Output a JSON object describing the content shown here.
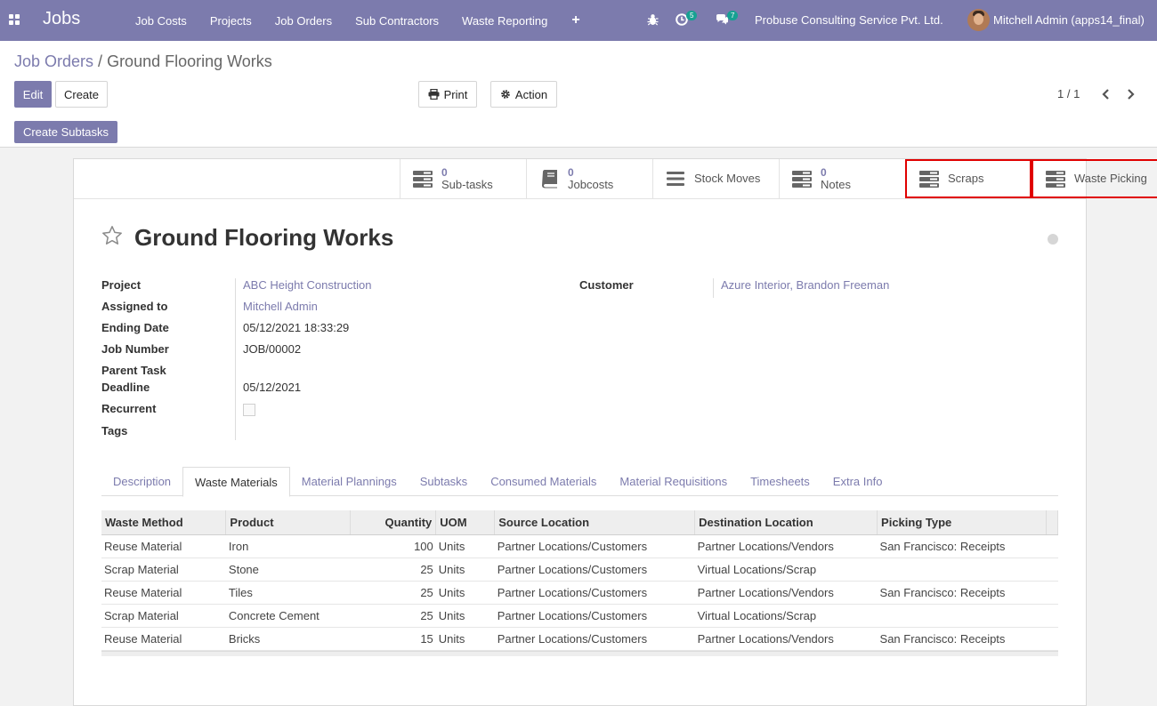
{
  "navbar": {
    "brand": "Jobs",
    "menu": [
      "Job Costs",
      "Projects",
      "Job Orders",
      "Sub Contractors",
      "Waste Reporting"
    ],
    "plus": "+",
    "activity_badge": "5",
    "messages_badge": "7",
    "company": "Probuse Consulting Service Pvt. Ltd.",
    "user": "Mitchell Admin (apps14_final)"
  },
  "breadcrumb": {
    "parent": "Job Orders",
    "separator": "/",
    "current": "Ground Flooring Works"
  },
  "buttons": {
    "edit": "Edit",
    "create": "Create",
    "print": "Print",
    "action": "Action",
    "create_subtasks": "Create Subtasks"
  },
  "pager": "1 / 1",
  "smart_buttons": [
    {
      "value": "0",
      "label": "Sub-tasks",
      "icon": "tasks-icon"
    },
    {
      "value": "0",
      "label": "Jobcosts",
      "icon": "book-icon"
    },
    {
      "value": "",
      "label": "Stock Moves",
      "icon": "list-icon"
    },
    {
      "value": "0",
      "label": "Notes",
      "icon": "tasks-icon"
    },
    {
      "value": "",
      "label": "Scraps",
      "icon": "tasks-icon",
      "highlighted": true
    },
    {
      "value": "",
      "label": "Waste Picking",
      "icon": "tasks-icon",
      "highlighted": true
    }
  ],
  "record": {
    "title": "Ground Flooring Works",
    "fields": {
      "project_label": "Project",
      "project": "ABC Height Construction",
      "assigned_label": "Assigned to",
      "assigned": "Mitchell Admin",
      "ending_label": "Ending Date",
      "ending": "05/12/2021 18:33:29",
      "jobnum_label": "Job Number",
      "jobnum": "JOB/00002",
      "parent_label": "Parent Task",
      "deadline_label": "Deadline",
      "deadline": "05/12/2021",
      "recurrent_label": "Recurrent",
      "tags_label": "Tags",
      "customer_label": "Customer",
      "customer": "Azure Interior, Brandon Freeman"
    }
  },
  "tabs": [
    "Description",
    "Waste Materials",
    "Material Plannings",
    "Subtasks",
    "Consumed Materials",
    "Material Requisitions",
    "Timesheets",
    "Extra Info"
  ],
  "active_tab": "Waste Materials",
  "table": {
    "columns": [
      "Waste Method",
      "Product",
      "Quantity",
      "UOM",
      "Source Location",
      "Destination Location",
      "Picking Type"
    ],
    "rows": [
      [
        "Reuse Material",
        "Iron",
        "100",
        "Units",
        "Partner Locations/Customers",
        "Partner Locations/Vendors",
        "San Francisco: Receipts"
      ],
      [
        "Scrap Material",
        "Stone",
        "25",
        "Units",
        "Partner Locations/Customers",
        "Virtual Locations/Scrap",
        ""
      ],
      [
        "Reuse Material",
        "Tiles",
        "25",
        "Units",
        "Partner Locations/Customers",
        "Partner Locations/Vendors",
        "San Francisco: Receipts"
      ],
      [
        "Scrap Material",
        "Concrete Cement",
        "25",
        "Units",
        "Partner Locations/Customers",
        "Virtual Locations/Scrap",
        ""
      ],
      [
        "Reuse Material",
        "Bricks",
        "15",
        "Units",
        "Partner Locations/Customers",
        "Partner Locations/Vendors",
        "San Francisco: Receipts"
      ]
    ]
  },
  "colors": {
    "brand": "#7c7bad",
    "highlight": "#e00000",
    "badge": "#17a192"
  }
}
